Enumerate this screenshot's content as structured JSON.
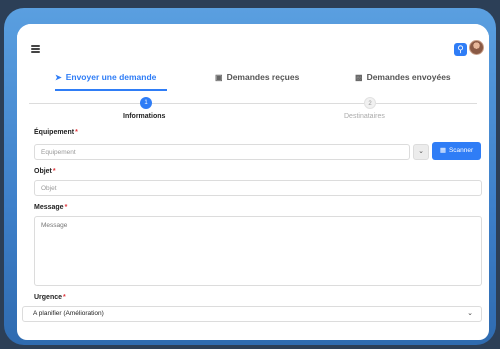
{
  "topbar": {
    "menu_icon": "hamburger-icon",
    "search_icon": "search-icon"
  },
  "tabs": [
    {
      "label": "Envoyer une demande",
      "icon": "send-icon",
      "active": true
    },
    {
      "label": "Demandes reçues",
      "icon": "inbox-icon",
      "active": false
    },
    {
      "label": "Demandes envoyées",
      "icon": "outbox-icon",
      "active": false
    }
  ],
  "steps": [
    {
      "number": "1",
      "label": "Informations",
      "active": true
    },
    {
      "number": "2",
      "label": "Destinataires",
      "active": false
    }
  ],
  "form": {
    "equipement": {
      "label": "Équipement",
      "required": "*",
      "placeholder": "Équipement"
    },
    "scan_button": "Scanner",
    "objet": {
      "label": "Objet",
      "required": "*",
      "placeholder": "Objet"
    },
    "message": {
      "label": "Message",
      "required": "*",
      "placeholder": "Message"
    },
    "urgence": {
      "label": "Urgence",
      "required": "*",
      "value": "A planifier (Amélioration)"
    }
  },
  "colors": {
    "accent": "#2f7df6",
    "required": "#e0383e"
  }
}
